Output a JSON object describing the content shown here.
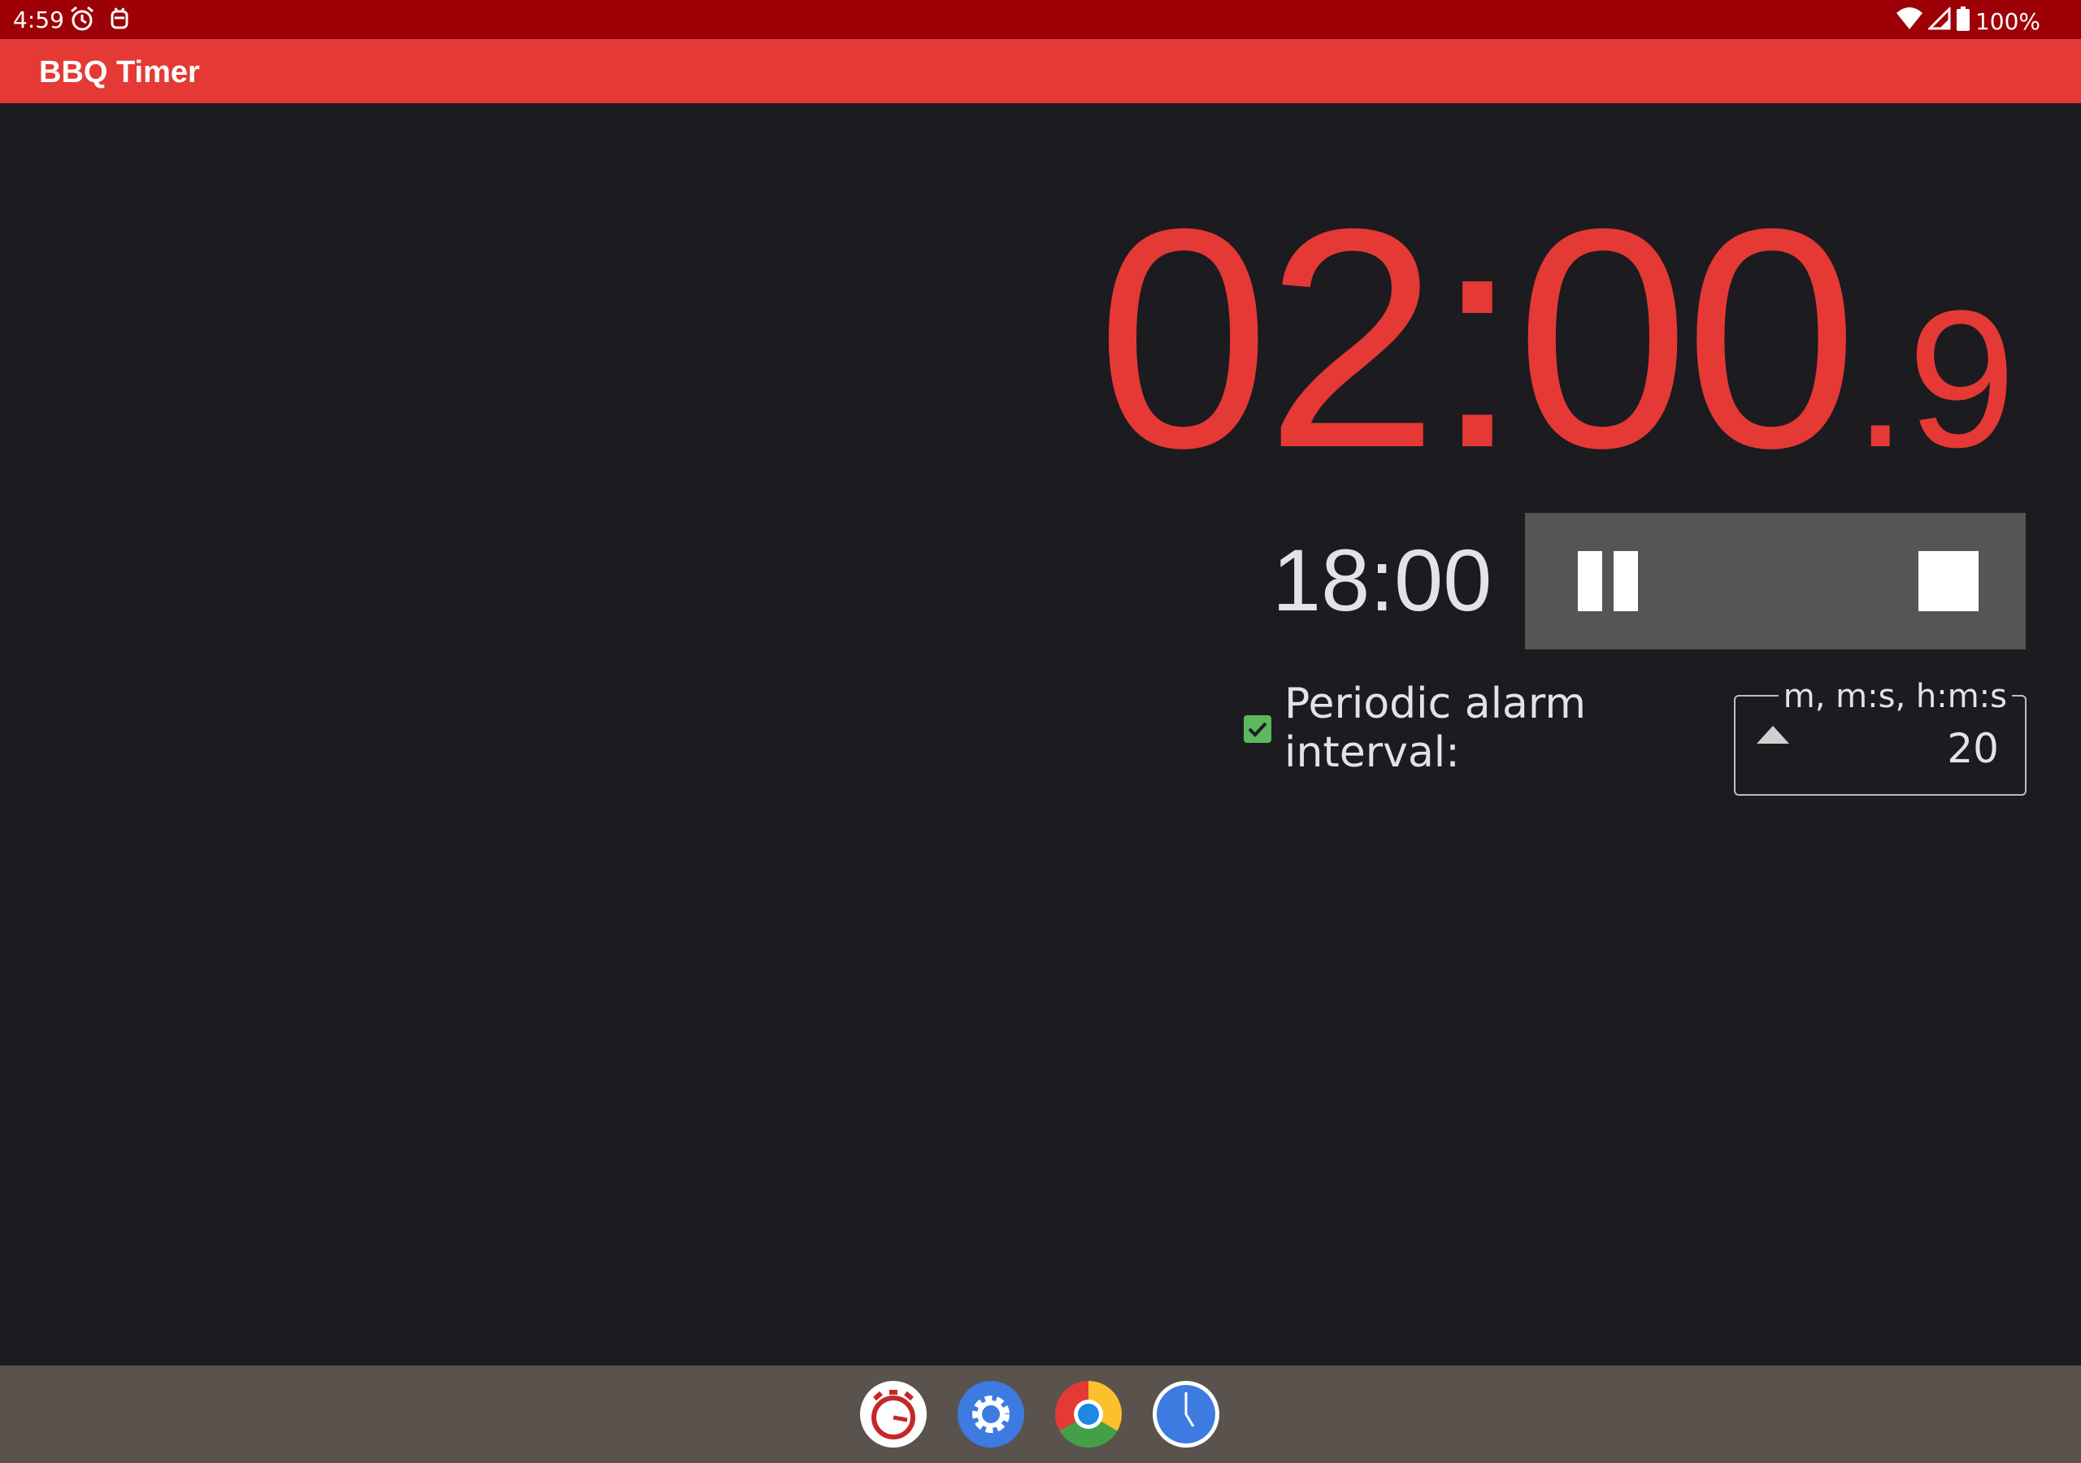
{
  "status_bar": {
    "time": "4:59",
    "battery": "100%",
    "icons": [
      "alarm-icon",
      "notification-icon",
      "wifi-icon",
      "signal-icon",
      "battery-icon"
    ]
  },
  "app_bar": {
    "title": "BBQ Timer"
  },
  "timer": {
    "main": "02:00",
    "tenths": ".9",
    "elapsed": "18:00"
  },
  "controls": {
    "pause_icon": "pause-icon",
    "stop_icon": "stop-icon"
  },
  "periodic_alarm": {
    "checked": true,
    "label_line1": "Periodic alarm",
    "label_line2": "interval:",
    "field_label": "m, m:s, h:m:s",
    "value": "20"
  },
  "dock": {
    "apps": [
      "bbq-timer-app-icon",
      "settings-app-icon",
      "chrome-app-icon",
      "clock-app-icon"
    ]
  },
  "colors": {
    "status_bar": "#9e0007",
    "app_bar": "#e53935",
    "timer_text": "#e53935",
    "background": "#1c1b20",
    "controls_bg": "#555555",
    "checkbox": "#5cb85c",
    "taskbar": "#5a524c"
  }
}
